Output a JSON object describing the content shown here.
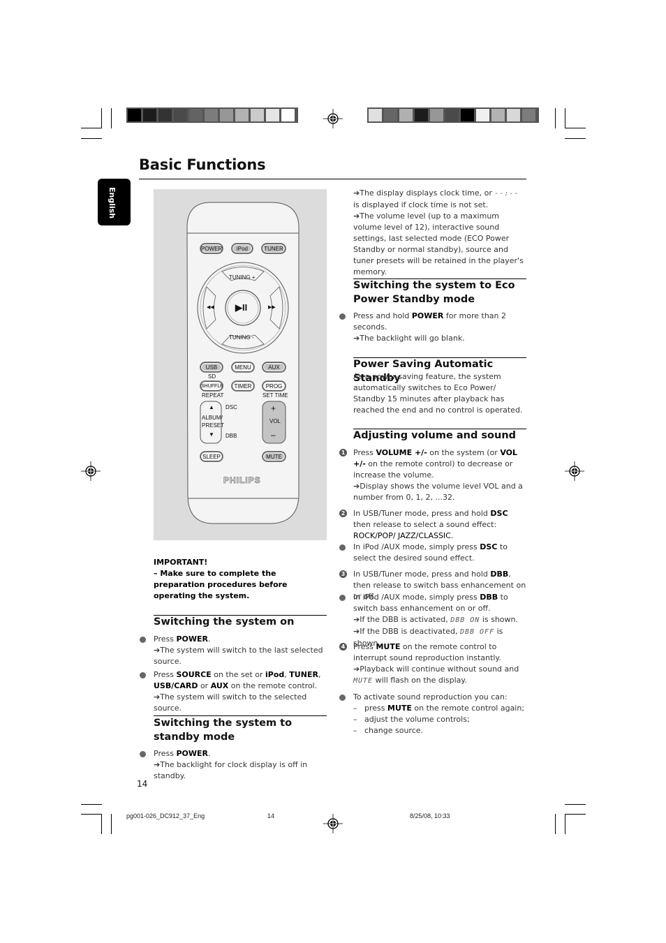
{
  "page": {
    "title": "Basic Functions",
    "language_tab": "English",
    "page_number": "14"
  },
  "print_marks": {
    "color_bar_left": [
      "#000000",
      "#1c1c1c",
      "#333333",
      "#4a4a4a",
      "#636363",
      "#7c7c7c",
      "#979797",
      "#b2b2b2",
      "#cbcbcb",
      "#e4e4e4",
      "#ffffff"
    ],
    "color_bar_right": [
      "#e0e0e0",
      "#666666",
      "#b0b0b0",
      "#1c1c1c",
      "#979797",
      "#4a4a4a",
      "#000000",
      "#f0f0f0",
      "#b2b2b2",
      "#d8d8d8",
      "#7c7c7c"
    ],
    "footer_file": "pg001-026_DC912_37_Eng",
    "footer_page": "14",
    "footer_date": "8/25/08, 10:33"
  },
  "remote": {
    "brand": "PHILIPS",
    "buttons": {
      "power": "POWER",
      "ipod": "iPod",
      "tuner": "TUNER",
      "tuning_up": "TUNING +",
      "tuning_down": "TUNING -",
      "prev": "◀◀",
      "play_pause": "▶II",
      "next": "▶▶",
      "usb": "USB",
      "menu": "MENU",
      "aux": "AUX",
      "shuffle": "SHUFFLE",
      "timer": "TIMER",
      "prog": "PROG",
      "album_up": "▲",
      "album_label": "ALBUM/ PRESET",
      "album_down": "▼",
      "vol_plus": "+",
      "vol_label": "VOL",
      "vol_minus": "–",
      "sleep": "SLEEP",
      "mute": "MUTE"
    },
    "labels": {
      "sd": "SD",
      "repeat": "REPEAT",
      "set_time": "SET TIME",
      "dsc": "DSC",
      "dbb": "DBB"
    }
  },
  "left": {
    "important_title": "IMPORTANT!",
    "important_text": "–  Make sure to complete the preparation procedures before operating the system.",
    "on": {
      "heading": "Switching the system on",
      "b1_pre": "Press ",
      "b1_bold": "POWER",
      "b1_post": ".",
      "b1_result": "The system will switch to the last selected source.",
      "b2_parts": [
        "Press ",
        "SOURCE",
        " on the set or ",
        "iPod",
        ", ",
        "TUNER",
        ", ",
        "USB/CARD",
        " or ",
        "AUX",
        " on the remote control."
      ],
      "b2_result": "The system will switch to the selected source."
    },
    "standby": {
      "heading": "Switching the system to standby mode",
      "b1_pre": "Press ",
      "b1_bold": "POWER",
      "b1_post": ".",
      "b1_result": "The backlight for clock display is off in standby."
    }
  },
  "right": {
    "intro_r1_pre": "The display displays clock time, or ",
    "intro_r1_lcd": "--:--",
    "intro_r1_post": " is displayed if clock time is not set.",
    "intro_r2": "The volume level (up to a maximum volume level of 12), interactive sound settings, last selected mode (ECO Power  Standby or normal standby), source and tuner presets will be retained in the player's memory.",
    "eco": {
      "heading": "Switching the system to Eco Power Standby mode",
      "b1_pre": "Press and hold ",
      "b1_bold": "POWER",
      "b1_post": " for more than 2 seconds.",
      "b1_result": "The backlight will go blank."
    },
    "auto": {
      "heading": "Power Saving Automatic Standby",
      "text": "As a power-saving feature, the system automatically switches to Eco Power/ Standby 15 minutes after playback has reached the end and no control is operated."
    },
    "volume": {
      "heading": "Adjusting volume and sound",
      "s1_num": "1",
      "s1_parts": [
        "Press ",
        "VOLUME +/-",
        " on the system (or ",
        "VOL +/-",
        " on the remote control) to decrease or increase the volume."
      ],
      "s1_result": "Display shows the volume level VOL and a number from 0, 1, 2, ...32.",
      "s2_num": "2",
      "s2_parts": [
        "In USB/Tuner mode, press and hold ",
        "DSC",
        " then release to select a sound effect: ",
        "ROCK/POP/ JAZZ/CLASSIC",
        "."
      ],
      "s2b_parts": [
        "In iPod /AUX mode, simply press ",
        "DSC",
        " to select the desired sound effect."
      ],
      "s3_num": "3",
      "s3_parts": [
        "In USB/Tuner mode, press and hold ",
        "DBB",
        ", then release to switch bass enhancement on or off."
      ],
      "s3b_parts": [
        "In iPod /AUX mode, simply press ",
        "DBB",
        " to switch bass enhancement on or off."
      ],
      "s3_r1_pre": "If the DBB is activated, ",
      "s3_r1_lcd": "DBB ON",
      "s3_r1_post": " is shown.",
      "s3_r2_pre": "If the DBB is deactivated, ",
      "s3_r2_lcd": "DBB OFF",
      "s3_r2_post": " is shown.",
      "s4_num": "4",
      "s4_parts": [
        "Press ",
        "MUTE",
        " on the remote control to interrupt sound reproduction instantly."
      ],
      "s4_result_pre": "Playback will continue without sound and ",
      "s4_result_lcd": "MUTE",
      "s4_result_post": "  will flash on the display.",
      "s5_text": "To activate sound reproduction you can:",
      "s5_d1_parts": [
        "press ",
        "MUTE",
        " on the remote control again;"
      ],
      "s5_d2": "adjust the volume controls;",
      "s5_d3": "change source."
    }
  }
}
